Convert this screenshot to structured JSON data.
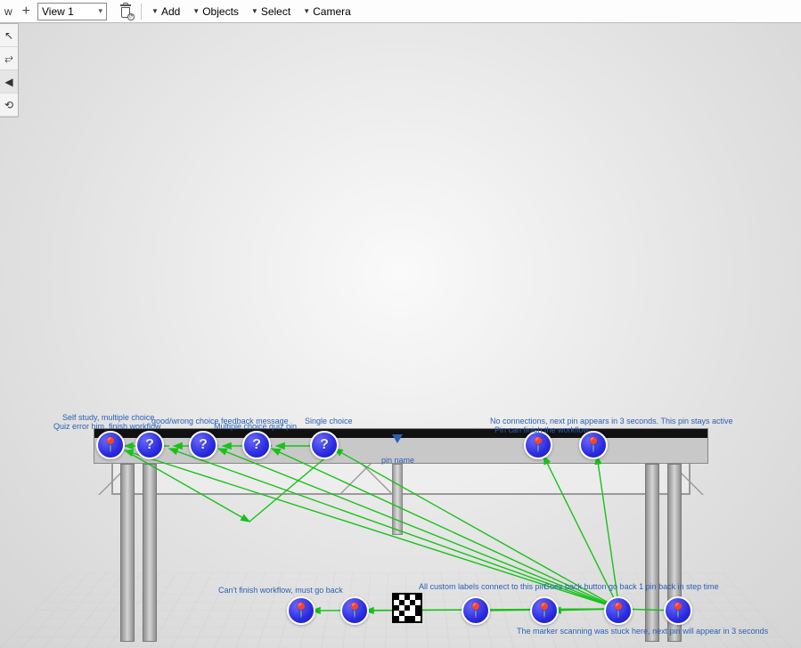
{
  "toolbar": {
    "leading_label": "w",
    "view_select": "View 1",
    "menus": {
      "add": "Add",
      "objects": "Objects",
      "select": "Select",
      "camera": "Camera"
    }
  },
  "viewport": {
    "center_pin_label": "pin name",
    "labels": {
      "top_left_1": "Self study, multiple choice",
      "top_left_2": "Quiz error him, finish workflow",
      "top_left_3": "good/wrong choice feedback message",
      "top_left_4": "Multiple choice quiz pin",
      "top_left_5": "Single choice",
      "top_right_1": "No connections, next pin appears in 3 seconds. This pin stays active",
      "top_right_2": "Pin can finish the workflow",
      "bottom_left": "Can't finish workflow, must go back",
      "bottom_mid": "All custom labels connect to this pin",
      "bottom_mid2": "Goes back button go back 1 pin back in step time",
      "bottom_right": "The marker scanning was stuck here, next pin will appear in 3 seconds"
    }
  }
}
